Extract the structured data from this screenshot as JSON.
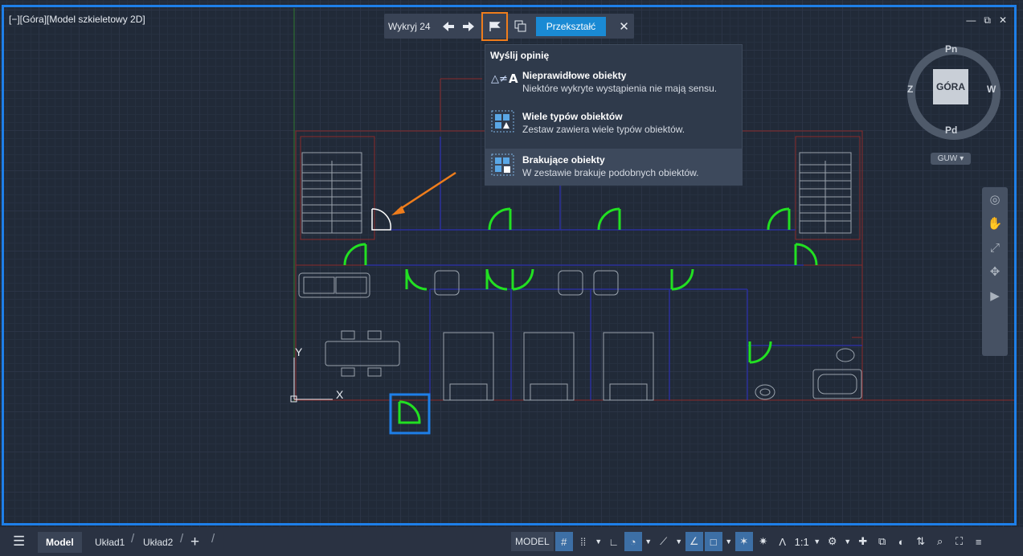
{
  "viewport": {
    "label": "[−][Góra][Model szkieletowy 2D]",
    "window_controls": [
      "—",
      "⧉",
      "✕"
    ]
  },
  "detection_toolbar": {
    "count_label": "Wykryj 24",
    "convert_label": "Przekształć",
    "close_glyph": "✕"
  },
  "feedback_menu": {
    "header": "Wyślij opinię",
    "items": [
      {
        "title": "Nieprawidłowe obiekty",
        "description": "Niektóre wykryte wystąpienia nie mają sensu."
      },
      {
        "title": "Wiele typów obiektów",
        "description": "Zestaw zawiera wiele typów obiektów."
      },
      {
        "title": "Brakujące obiekty",
        "description": "W zestawie brakuje podobnych obiektów."
      }
    ],
    "selected_index": 2
  },
  "navcube": {
    "face": "GÓRA",
    "north": "Pn",
    "south": "Pd",
    "west": "W",
    "east_label": "Z",
    "ucs": "GUW"
  },
  "ucs_axes": {
    "x": "X",
    "y": "Y"
  },
  "colors": {
    "accent_blue": "#1e7fe8",
    "highlight_orange": "#ef7d1c",
    "door_green": "#22e022",
    "wall_red": "#8a2a2a",
    "wall_blue": "#2a2f9a"
  },
  "status_bar": {
    "tabs": [
      "Model",
      "Układ1",
      "Układ2"
    ],
    "add_tab": "+",
    "model_button": "MODEL",
    "scale": "1:1"
  }
}
